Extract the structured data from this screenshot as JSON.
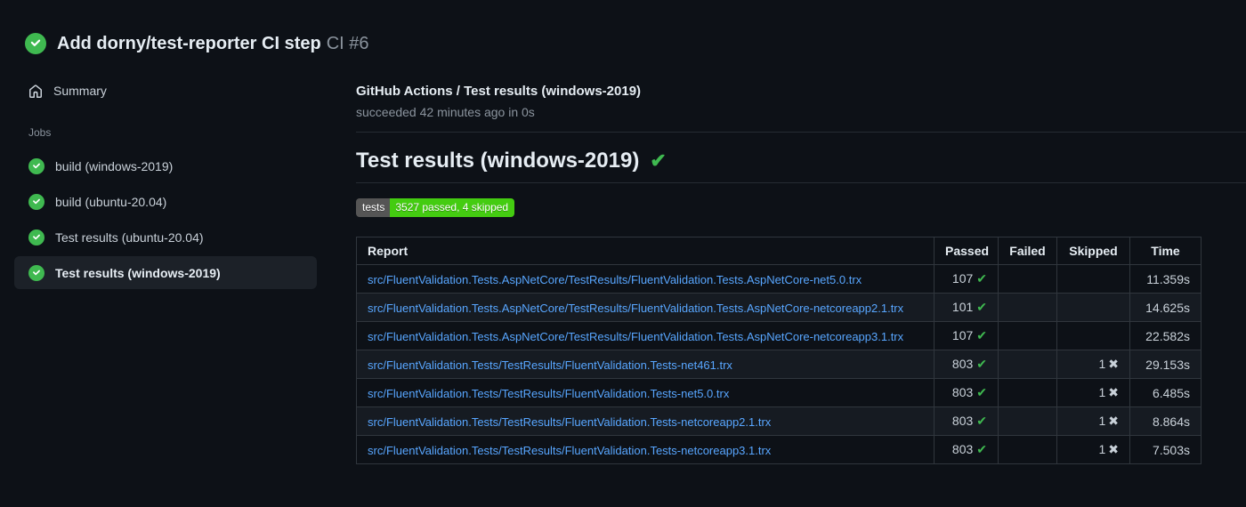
{
  "header": {
    "title": "Add dorny/test-reporter CI step",
    "run_label": "CI #6",
    "status": "success"
  },
  "sidebar": {
    "summary_label": "Summary",
    "jobs_section_label": "Jobs",
    "jobs": [
      {
        "label": "build (windows-2019)",
        "status": "success",
        "selected": false
      },
      {
        "label": "build (ubuntu-20.04)",
        "status": "success",
        "selected": false
      },
      {
        "label": "Test results (ubuntu-20.04)",
        "status": "success",
        "selected": false
      },
      {
        "label": "Test results (windows-2019)",
        "status": "success",
        "selected": true
      }
    ]
  },
  "main": {
    "job_header": {
      "title": "GitHub Actions / Test results (windows-2019)",
      "status_line": "succeeded 42 minutes ago in 0s"
    },
    "report": {
      "heading": "Test results (windows-2019)",
      "heading_status": "success"
    },
    "badge": {
      "label": "tests",
      "value": "3527 passed, 4 skipped"
    },
    "table": {
      "columns": [
        "Report",
        "Passed",
        "Failed",
        "Skipped",
        "Time"
      ],
      "rows": [
        {
          "report": "src/FluentValidation.Tests.AspNetCore/TestResults/FluentValidation.Tests.AspNetCore-net5.0.trx",
          "passed": "107",
          "failed": "",
          "skipped": "",
          "time": "11.359s"
        },
        {
          "report": "src/FluentValidation.Tests.AspNetCore/TestResults/FluentValidation.Tests.AspNetCore-netcoreapp2.1.trx",
          "passed": "101",
          "failed": "",
          "skipped": "",
          "time": "14.625s"
        },
        {
          "report": "src/FluentValidation.Tests.AspNetCore/TestResults/FluentValidation.Tests.AspNetCore-netcoreapp3.1.trx",
          "passed": "107",
          "failed": "",
          "skipped": "",
          "time": "22.582s"
        },
        {
          "report": "src/FluentValidation.Tests/TestResults/FluentValidation.Tests-net461.trx",
          "passed": "803",
          "failed": "",
          "skipped": "1",
          "time": "29.153s"
        },
        {
          "report": "src/FluentValidation.Tests/TestResults/FluentValidation.Tests-net5.0.trx",
          "passed": "803",
          "failed": "",
          "skipped": "1",
          "time": "6.485s"
        },
        {
          "report": "src/FluentValidation.Tests/TestResults/FluentValidation.Tests-netcoreapp2.1.trx",
          "passed": "803",
          "failed": "",
          "skipped": "1",
          "time": "8.864s"
        },
        {
          "report": "src/FluentValidation.Tests/TestResults/FluentValidation.Tests-netcoreapp3.1.trx",
          "passed": "803",
          "failed": "",
          "skipped": "1",
          "time": "7.503s"
        }
      ]
    }
  },
  "icons": {
    "check_glyph": "✔",
    "cross_glyph": "✖"
  },
  "colors": {
    "success_green": "#3fb950",
    "link_blue": "#58a6ff",
    "badge_label_bg": "#555555",
    "badge_value_bg": "#44cc11"
  }
}
